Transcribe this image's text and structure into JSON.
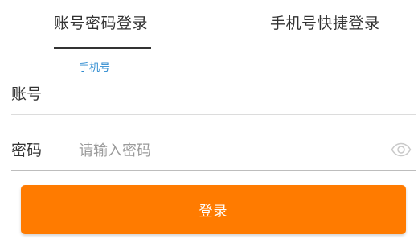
{
  "tabs": {
    "account_login": "账号密码登录",
    "phone_quick_login": "手机号快捷登录"
  },
  "account_row": {
    "floating_label": "手机号",
    "label": "账号",
    "value": ""
  },
  "password_row": {
    "label": "密码",
    "placeholder": "请输入密码",
    "toggle_icon": "eye-icon"
  },
  "login_button": {
    "label": "登录",
    "color": "#ff7b00"
  },
  "accent_color": "#2e8bd0"
}
